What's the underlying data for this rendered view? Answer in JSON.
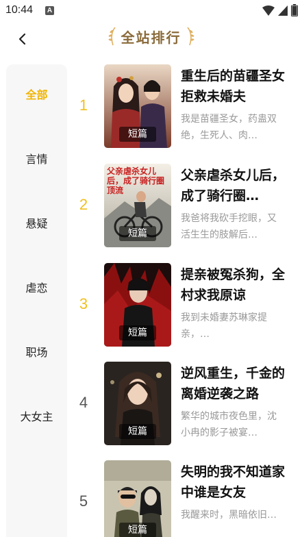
{
  "status_bar": {
    "time": "10:44",
    "notification_icon": "A"
  },
  "header": {
    "title": "全站排行"
  },
  "sidebar": {
    "items": [
      {
        "label": "全部",
        "active": true
      },
      {
        "label": "言情",
        "active": false
      },
      {
        "label": "悬疑",
        "active": false
      },
      {
        "label": "虐恋",
        "active": false
      },
      {
        "label": "职场",
        "active": false
      },
      {
        "label": "大女主",
        "active": false
      }
    ]
  },
  "books": [
    {
      "rank": "1",
      "rank_color": "#f0c020",
      "title": "重生后的苗疆圣女拒救未婚夫",
      "tag": "短篇",
      "desc": "我是苗疆圣女，药蛊双绝，生死人、肉…"
    },
    {
      "rank": "2",
      "rank_color": "#f0c020",
      "title": "父亲虐杀女儿后，成了骑行圈…",
      "tag": "短篇",
      "desc": "我爸将我砍手挖眼，又活生生的肢解后…",
      "cover_text": "父亲虐杀女儿后，成了骑行圈顶流"
    },
    {
      "rank": "3",
      "rank_color": "#f0c020",
      "title": "提亲被冤杀狗，全村求我原谅",
      "tag": "短篇",
      "desc": "我到未婚妻苏琳家提亲，…"
    },
    {
      "rank": "4",
      "rank_color": "#555555",
      "title": "逆风重生，千金的离婚逆袭之路",
      "tag": "短篇",
      "desc": "繁华的城市夜色里，沈小冉的影子被宴…"
    },
    {
      "rank": "5",
      "rank_color": "#555555",
      "title": "失明的我不知道家中谁是女友",
      "tag": "短篇",
      "desc": "我醒来时，黑暗依旧…"
    }
  ],
  "colors": {
    "accent": "#f0b400",
    "title_gold": "#8a6a3a",
    "desc_gray": "#999999"
  }
}
